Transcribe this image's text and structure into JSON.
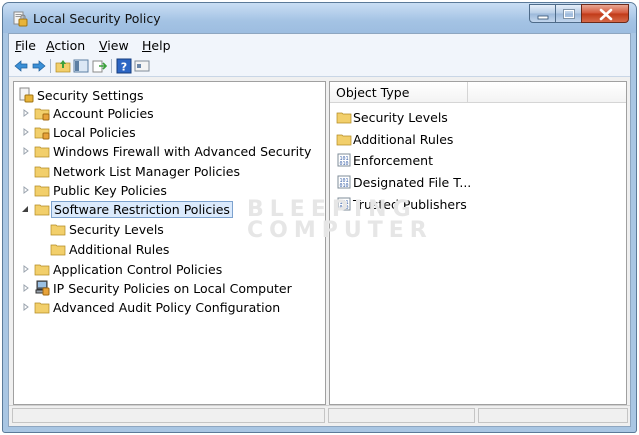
{
  "window": {
    "title": "Local Security Policy"
  },
  "menubar": [
    {
      "key": "F",
      "rest": "ile"
    },
    {
      "key": "A",
      "rest": "ction"
    },
    {
      "key": "V",
      "rest": "iew"
    },
    {
      "key": "H",
      "rest": "elp"
    }
  ],
  "toolbar": {
    "icons": [
      "back-arrow-icon",
      "forward-arrow-icon",
      "up-folder-icon",
      "show-hide-tree-icon",
      "export-list-icon",
      "help-icon",
      "properties-icon"
    ]
  },
  "tree": {
    "root": "Security Settings",
    "items": [
      {
        "label": "Account Policies"
      },
      {
        "label": "Local Policies"
      },
      {
        "label": "Windows Firewall with Advanced Security"
      },
      {
        "label": "Network List Manager Policies"
      },
      {
        "label": "Public Key Policies"
      },
      {
        "label": "Software Restriction Policies"
      },
      {
        "label": "Security Levels"
      },
      {
        "label": "Additional Rules"
      },
      {
        "label": "Application Control Policies"
      },
      {
        "label": "IP Security Policies on Local Computer"
      },
      {
        "label": "Advanced Audit Policy Configuration"
      }
    ]
  },
  "list": {
    "column_header": "Object Type",
    "items": [
      {
        "label": "Security Levels"
      },
      {
        "label": "Additional Rules"
      },
      {
        "label": "Enforcement"
      },
      {
        "label": "Designated File T..."
      },
      {
        "label": "Trusted Publishers"
      }
    ]
  },
  "watermark": {
    "line1": "BLEEPING",
    "line2": "COMPUTER"
  },
  "colors": {
    "titlebar": "#a4c3e4",
    "selection": "#dbeafc",
    "selection_border": "#7da2ce",
    "close_button": "#c13a18"
  }
}
